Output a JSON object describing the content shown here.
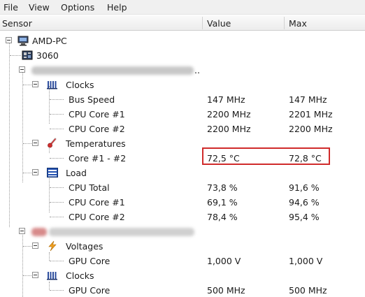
{
  "menu": [
    "File",
    "View",
    "Options",
    "Help"
  ],
  "columns": {
    "sensor": "Sensor",
    "value": "Value",
    "max": "Max"
  },
  "tree": {
    "root": {
      "label": "AMD-PC",
      "icon": "computer-icon"
    },
    "mainboard": {
      "label": "3060",
      "icon": "motherboard-icon"
    },
    "cpu": {
      "label_redacted": true,
      "trailing_text": "..",
      "clocks": {
        "label": "Clocks",
        "icon": "clock-bars-icon",
        "rows": [
          {
            "label": "Bus Speed",
            "value": "147 MHz",
            "max": "147 MHz"
          },
          {
            "label": "CPU Core #1",
            "value": "2200 MHz",
            "max": "2201 MHz"
          },
          {
            "label": "CPU Core #2",
            "value": "2200 MHz",
            "max": "2200 MHz"
          }
        ]
      },
      "temperatures": {
        "label": "Temperatures",
        "icon": "thermometer-icon",
        "rows": [
          {
            "label": "Core #1 - #2",
            "value": "72,5 °C",
            "max": "72,8 °C"
          }
        ]
      },
      "load": {
        "label": "Load",
        "icon": "load-bars-icon",
        "rows": [
          {
            "label": "CPU Total",
            "value": "73,8 %",
            "max": "91,6 %"
          },
          {
            "label": "CPU Core #1",
            "value": "69,1 %",
            "max": "94,6 %"
          },
          {
            "label": "CPU Core #2",
            "value": "78,4 %",
            "max": "95,4 %"
          }
        ]
      }
    },
    "gpu": {
      "label_redacted": true,
      "voltages": {
        "label": "Voltages",
        "icon": "lightning-icon",
        "rows": [
          {
            "label": "GPU Core",
            "value": "1,000 V",
            "max": "1,000 V"
          }
        ]
      },
      "clocks": {
        "label": "Clocks",
        "icon": "clock-bars-icon",
        "rows": [
          {
            "label": "GPU Core",
            "value": "500 MHz",
            "max": "500 MHz"
          }
        ]
      }
    }
  },
  "colors": {
    "highlight": "#d02b2b",
    "load_icon": "#1f4fa8",
    "thermometer": "#d22f2f",
    "lightning": "#f0a020"
  }
}
